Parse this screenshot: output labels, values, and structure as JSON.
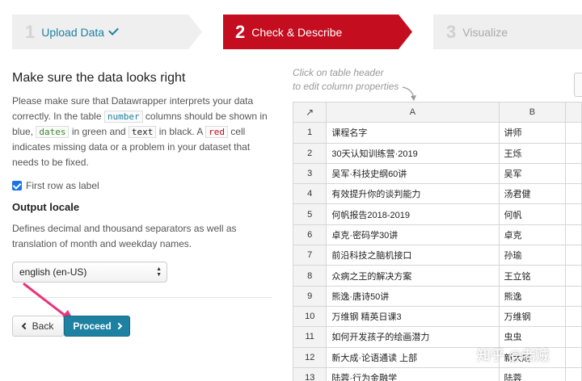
{
  "steps": [
    {
      "num": "1",
      "label": "Upload Data"
    },
    {
      "num": "2",
      "label": "Check & Describe"
    },
    {
      "num": "3",
      "label": "Visualize"
    }
  ],
  "left": {
    "title": "Make sure the data looks right",
    "desc_1": "Please make sure that Datawrapper interprets your data correctly. In the table ",
    "code_number": "number",
    "desc_2": " columns should be shown in blue, ",
    "code_dates": "dates",
    "desc_3": " in green and ",
    "code_text": "text",
    "desc_4": " in black. A ",
    "code_red": "red",
    "desc_5": " cell indicates missing data or a problem in your dataset that needs to be fixed.",
    "first_row_label": "First row as label",
    "first_row_checked": true,
    "locale_heading": "Output locale",
    "locale_desc": "Defines decimal and thousand separators as well as translation of month and weekday names.",
    "locale_value": "english (en-US)"
  },
  "buttons": {
    "back": "Back",
    "proceed": "Proceed"
  },
  "hint": {
    "line1": "Click on table header",
    "line2": "to edit column properties"
  },
  "table": {
    "corner_icon": "↗",
    "headers": [
      "A",
      "B"
    ],
    "rows": [
      {
        "idx": "1",
        "a": "课程名字",
        "b": "讲师"
      },
      {
        "idx": "2",
        "a": "30天认知训练营·2019",
        "b": "王烁"
      },
      {
        "idx": "3",
        "a": "吴军·科技史纲60讲",
        "b": "吴军"
      },
      {
        "idx": "4",
        "a": "有效提升你的谈判能力",
        "b": "汤君健"
      },
      {
        "idx": "5",
        "a": "何帆报告2018-2019",
        "b": "何帆"
      },
      {
        "idx": "6",
        "a": "卓克·密码学30讲",
        "b": "卓克"
      },
      {
        "idx": "7",
        "a": "前沿科技之脑机接口",
        "b": "孙瑜"
      },
      {
        "idx": "8",
        "a": "众病之王的解决方案",
        "b": "王立铭"
      },
      {
        "idx": "9",
        "a": "熊逸·唐诗50讲",
        "b": "熊逸"
      },
      {
        "idx": "10",
        "a": "万维钢 精英日课3",
        "b": "万维钢"
      },
      {
        "idx": "11",
        "a": "如何开发孩子的绘画潜力",
        "b": "虫虫"
      },
      {
        "idx": "12",
        "a": "新大成·论语通读 上部",
        "b": "新大成"
      },
      {
        "idx": "13",
        "a": "陆蓉·行为金融学",
        "b": "陆蓉"
      }
    ]
  },
  "watermark": "知乎 @老贼",
  "colors": {
    "accent_red": "#c40d1e",
    "accent_blue": "#1d81a2"
  }
}
